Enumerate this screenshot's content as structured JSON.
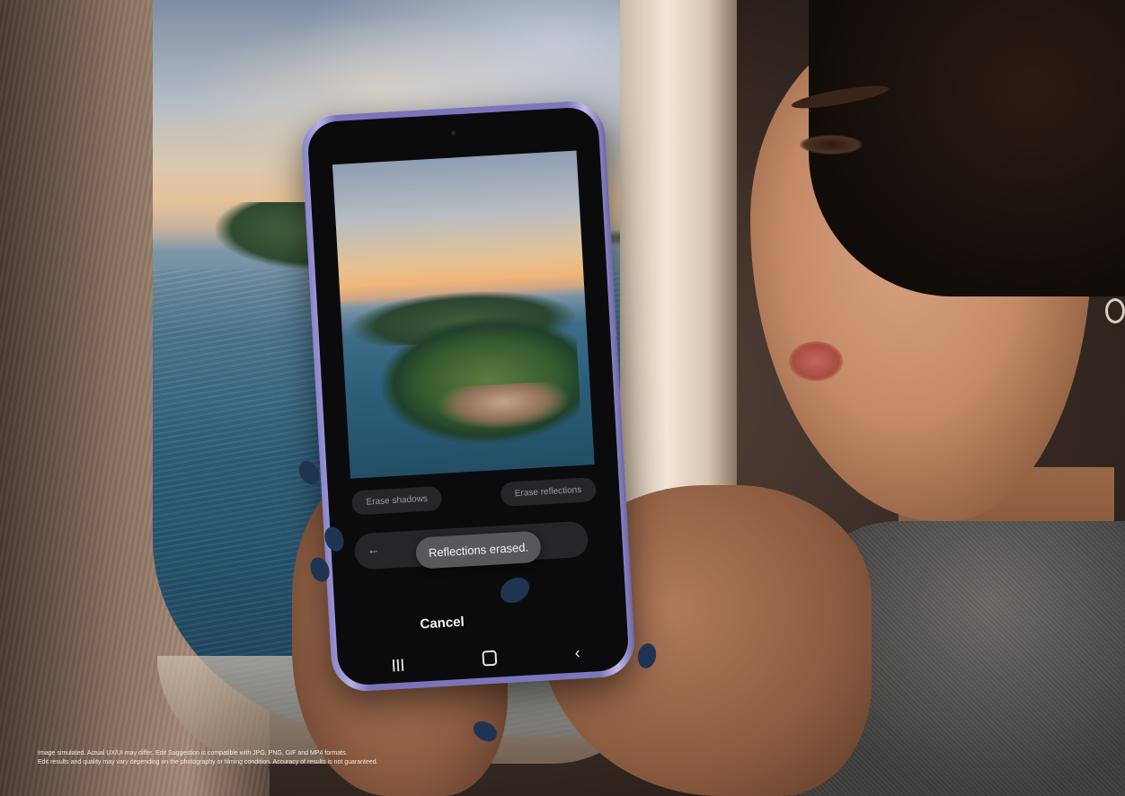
{
  "phone": {
    "chips": [
      "Erase shadows",
      "Erase reflections"
    ],
    "back_glyph": "←",
    "toast": "Reflections erased.",
    "cancel_label": "Cancel",
    "nav": {
      "recent_icon": "recent-apps-icon",
      "home_icon": "home-icon",
      "back_icon": "back-icon"
    }
  },
  "disclaimer": {
    "line1": "Image simulated. Actual UX/UI may differ. Edit Suggestion is compatible with JPG, PNG, GIF and MP4 formats.",
    "line2": "Edit results and quality may vary depending on the photography or filming condition. Accuracy of results is not guaranteed."
  },
  "colors": {
    "phone_frame": "#8a84c8",
    "toast_bg": "#57575c",
    "chip_bg": "#26262a"
  }
}
